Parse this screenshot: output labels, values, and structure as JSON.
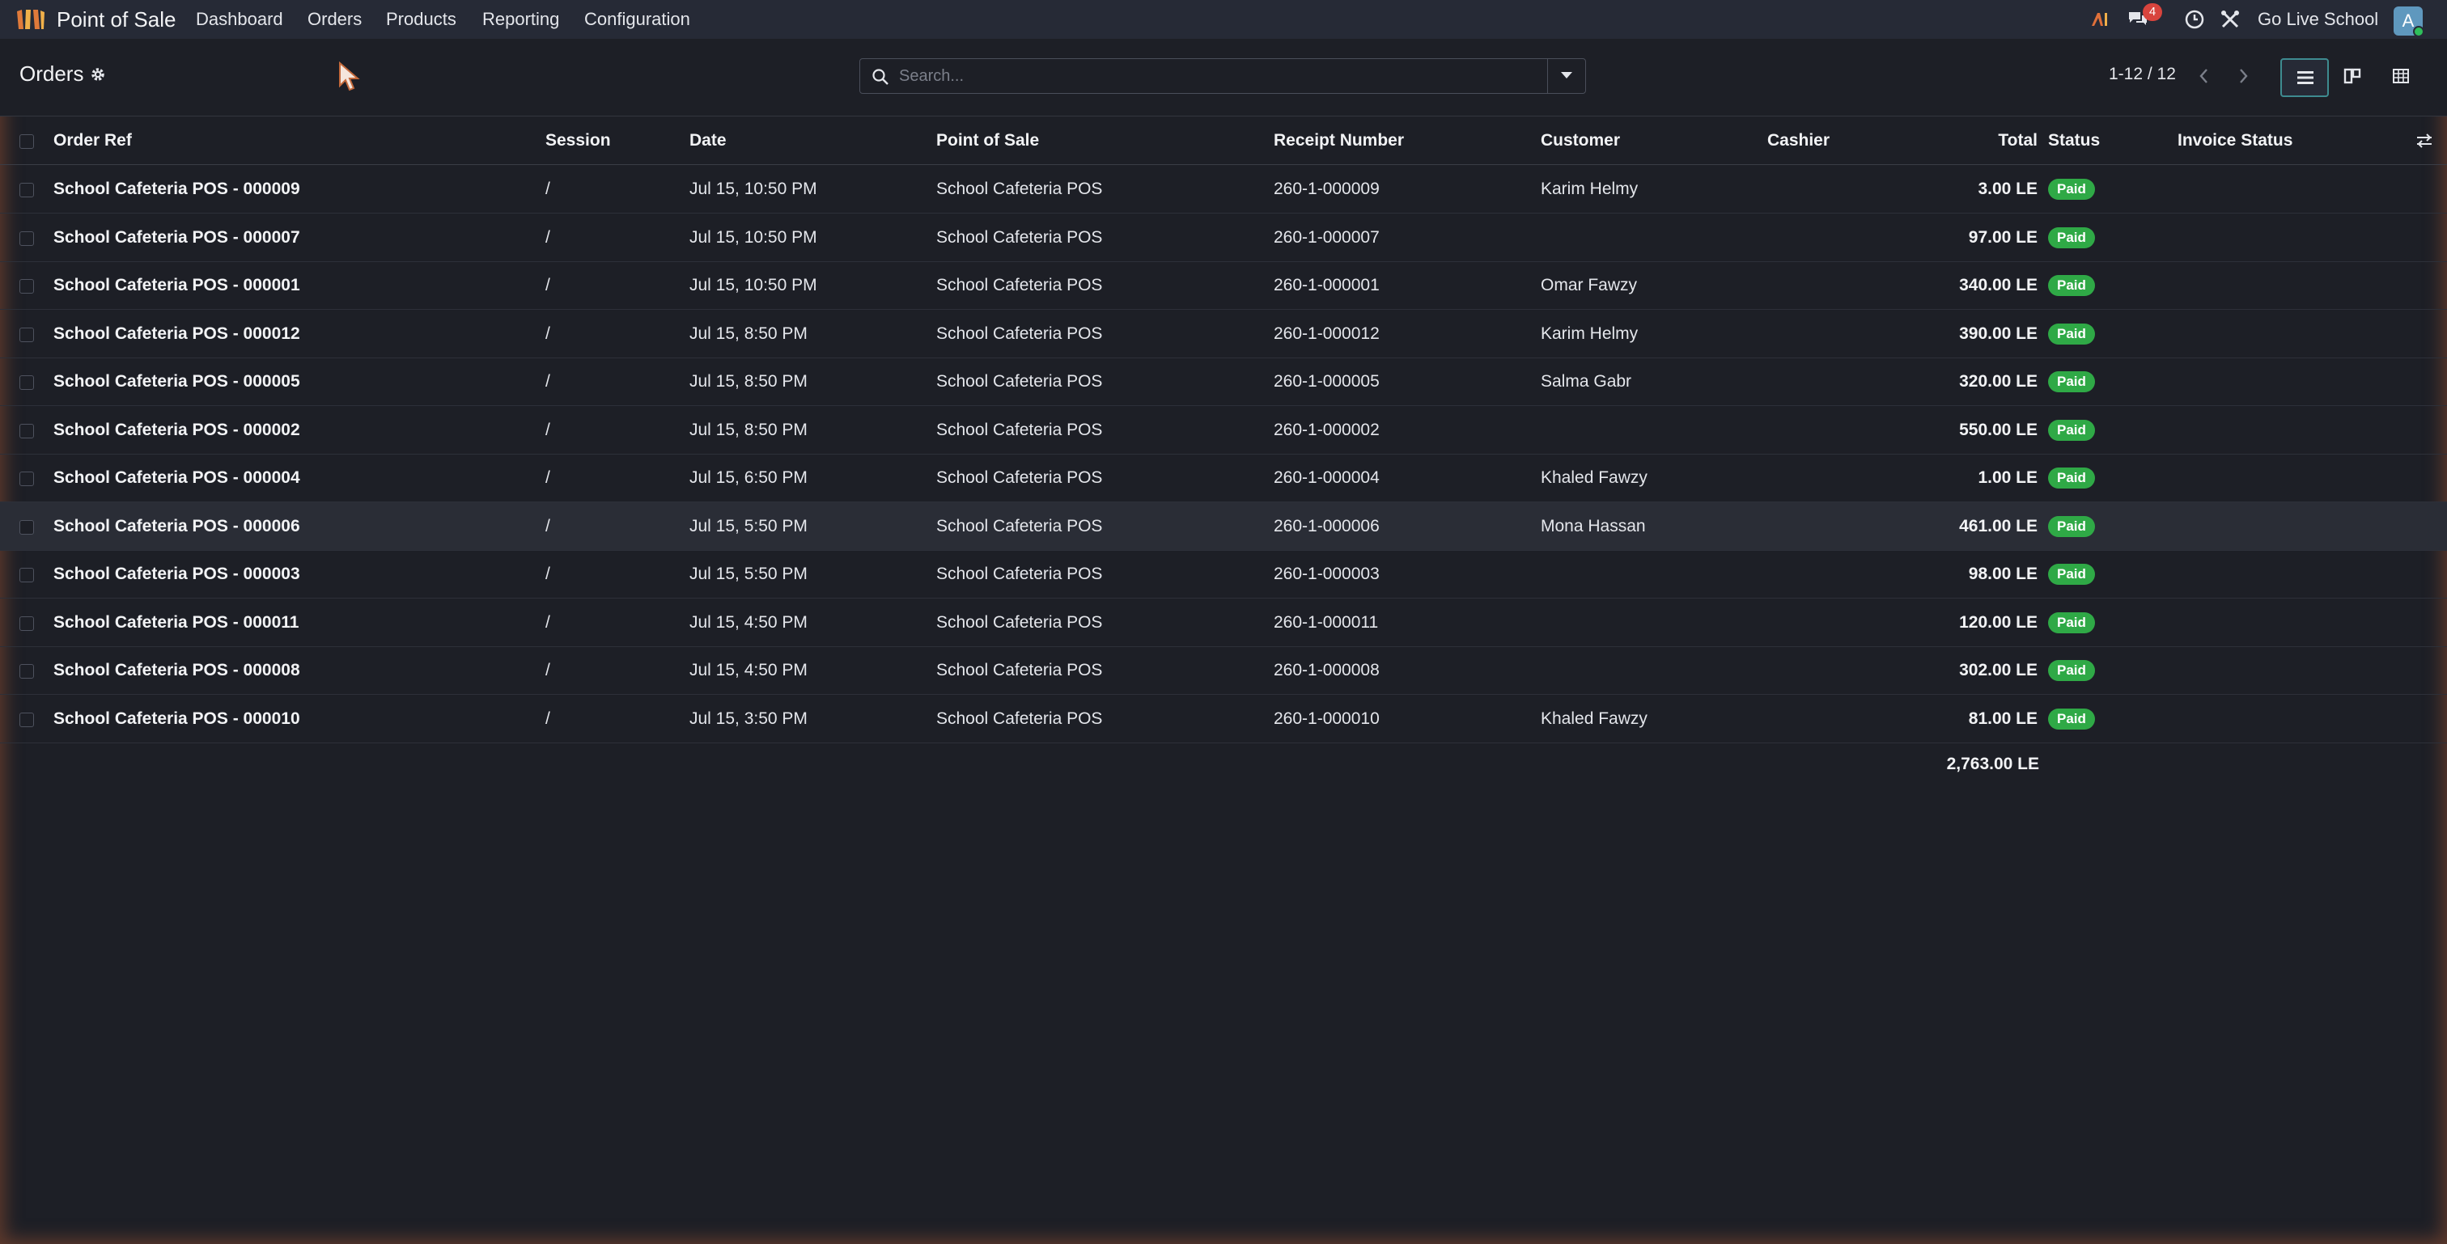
{
  "navbar": {
    "app_name": "Point of Sale",
    "menu": [
      "Dashboard",
      "Orders",
      "Products",
      "Reporting",
      "Configuration"
    ],
    "message_count": "4",
    "company": "Go Live School",
    "avatar_letter": "A"
  },
  "control_panel": {
    "title": "Orders",
    "search_placeholder": "Search...",
    "pager": "1-12 / 12"
  },
  "table": {
    "headers": {
      "order_ref": "Order Ref",
      "session": "Session",
      "date": "Date",
      "pos": "Point of Sale",
      "receipt": "Receipt Number",
      "customer": "Customer",
      "cashier": "Cashier",
      "total": "Total",
      "status": "Status",
      "invoice_status": "Invoice Status"
    },
    "rows": [
      {
        "ref": "School Cafeteria POS - 000009",
        "session": "/",
        "date": "Jul 15, 10:50 PM",
        "pos": "School Cafeteria POS",
        "receipt": "260-1-000009",
        "customer": "Karim Helmy",
        "cashier": "",
        "total": "3.00 LE",
        "status": "Paid",
        "invoice_status": ""
      },
      {
        "ref": "School Cafeteria POS - 000007",
        "session": "/",
        "date": "Jul 15, 10:50 PM",
        "pos": "School Cafeteria POS",
        "receipt": "260-1-000007",
        "customer": "",
        "cashier": "",
        "total": "97.00 LE",
        "status": "Paid",
        "invoice_status": ""
      },
      {
        "ref": "School Cafeteria POS - 000001",
        "session": "/",
        "date": "Jul 15, 10:50 PM",
        "pos": "School Cafeteria POS",
        "receipt": "260-1-000001",
        "customer": "Omar Fawzy",
        "cashier": "",
        "total": "340.00 LE",
        "status": "Paid",
        "invoice_status": ""
      },
      {
        "ref": "School Cafeteria POS - 000012",
        "session": "/",
        "date": "Jul 15, 8:50 PM",
        "pos": "School Cafeteria POS",
        "receipt": "260-1-000012",
        "customer": "Karim Helmy",
        "cashier": "",
        "total": "390.00 LE",
        "status": "Paid",
        "invoice_status": ""
      },
      {
        "ref": "School Cafeteria POS - 000005",
        "session": "/",
        "date": "Jul 15, 8:50 PM",
        "pos": "School Cafeteria POS",
        "receipt": "260-1-000005",
        "customer": "Salma Gabr",
        "cashier": "",
        "total": "320.00 LE",
        "status": "Paid",
        "invoice_status": ""
      },
      {
        "ref": "School Cafeteria POS - 000002",
        "session": "/",
        "date": "Jul 15, 8:50 PM",
        "pos": "School Cafeteria POS",
        "receipt": "260-1-000002",
        "customer": "",
        "cashier": "",
        "total": "550.00 LE",
        "status": "Paid",
        "invoice_status": ""
      },
      {
        "ref": "School Cafeteria POS - 000004",
        "session": "/",
        "date": "Jul 15, 6:50 PM",
        "pos": "School Cafeteria POS",
        "receipt": "260-1-000004",
        "customer": "Khaled Fawzy",
        "cashier": "",
        "total": "1.00 LE",
        "status": "Paid",
        "invoice_status": ""
      },
      {
        "ref": "School Cafeteria POS - 000006",
        "session": "/",
        "date": "Jul 15, 5:50 PM",
        "pos": "School Cafeteria POS",
        "receipt": "260-1-000006",
        "customer": "Mona Hassan",
        "cashier": "",
        "total": "461.00 LE",
        "status": "Paid",
        "invoice_status": ""
      },
      {
        "ref": "School Cafeteria POS - 000003",
        "session": "/",
        "date": "Jul 15, 5:50 PM",
        "pos": "School Cafeteria POS",
        "receipt": "260-1-000003",
        "customer": "",
        "cashier": "",
        "total": "98.00 LE",
        "status": "Paid",
        "invoice_status": ""
      },
      {
        "ref": "School Cafeteria POS - 000011",
        "session": "/",
        "date": "Jul 15, 4:50 PM",
        "pos": "School Cafeteria POS",
        "receipt": "260-1-000011",
        "customer": "",
        "cashier": "",
        "total": "120.00 LE",
        "status": "Paid",
        "invoice_status": ""
      },
      {
        "ref": "School Cafeteria POS - 000008",
        "session": "/",
        "date": "Jul 15, 4:50 PM",
        "pos": "School Cafeteria POS",
        "receipt": "260-1-000008",
        "customer": "",
        "cashier": "",
        "total": "302.00 LE",
        "status": "Paid",
        "invoice_status": ""
      },
      {
        "ref": "School Cafeteria POS - 000010",
        "session": "/",
        "date": "Jul 15, 3:50 PM",
        "pos": "School Cafeteria POS",
        "receipt": "260-1-000010",
        "customer": "Khaled Fawzy",
        "cashier": "",
        "total": "81.00 LE",
        "status": "Paid",
        "invoice_status": ""
      }
    ],
    "grand_total": "2,763.00 LE"
  },
  "colors": {
    "paid_badge": "#2fa946",
    "notification_badge": "#d8443d",
    "active_view_border": "#3e8b90"
  },
  "icons": [
    "pos-app-icon",
    "ai-icon",
    "chat-icon",
    "clock-icon",
    "tools-icon",
    "gear-icon",
    "search-icon",
    "dropdown-caret-icon",
    "chevron-left-icon",
    "chevron-right-icon",
    "list-view-icon",
    "kanban-view-icon",
    "grid-view-icon",
    "optional-columns-icon",
    "mouse-cursor-icon"
  ]
}
